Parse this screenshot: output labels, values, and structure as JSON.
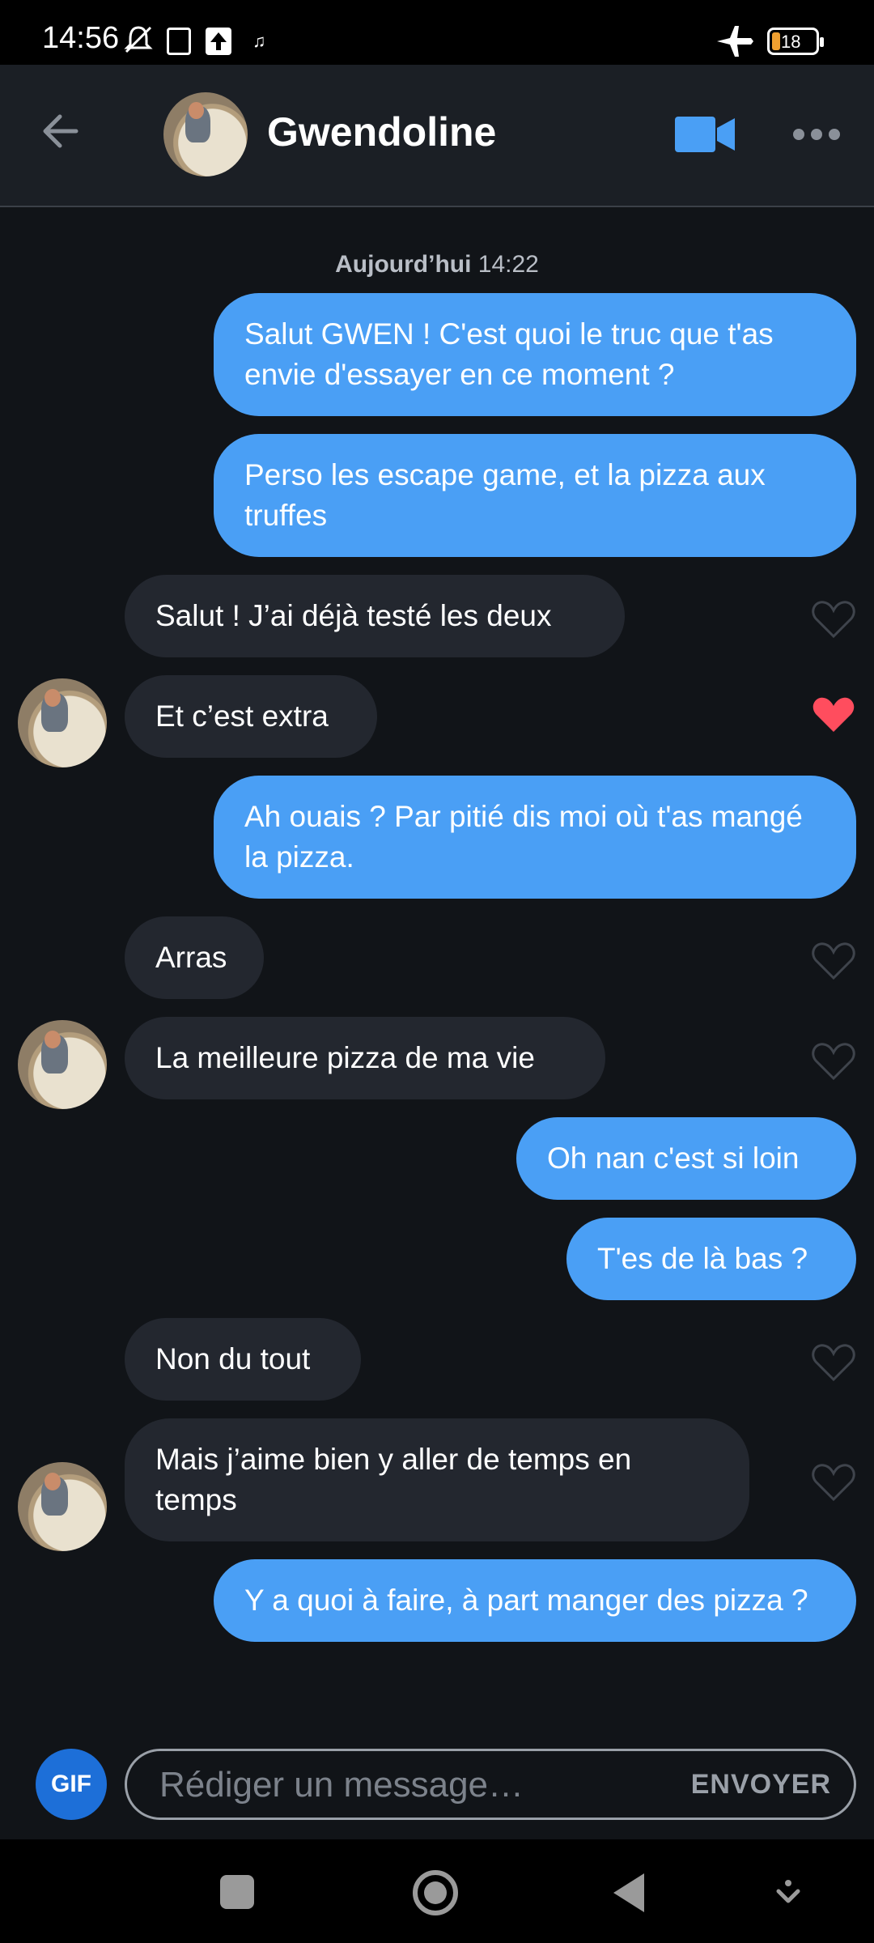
{
  "status_bar": {
    "time": "14:56",
    "battery": "18",
    "icons": [
      "mute-bell-icon",
      "battery-saver-icon",
      "upload-icon",
      "music-icon",
      "airplane-icon",
      "battery-icon"
    ]
  },
  "header": {
    "contact_name": "Gwendoline",
    "icons": [
      "back-arrow-icon",
      "video-camera-icon",
      "more-icon"
    ]
  },
  "chat": {
    "date_label": "Aujourd’hui",
    "date_time": "14:22",
    "messages": [
      {
        "dir": "out",
        "text": "Salut GWEN ! C'est quoi le truc que t'as envie d'essayer en ce moment ?"
      },
      {
        "dir": "out",
        "text": "Perso les escape game, et la pizza aux truffes"
      },
      {
        "dir": "in",
        "text": "Salut ! J’ai déjà testé les deux",
        "liked": false
      },
      {
        "dir": "in",
        "text": "Et c’est extra",
        "liked": true
      },
      {
        "dir": "out",
        "text": "Ah ouais ? Par pitié dis moi où t'as mangé la pizza."
      },
      {
        "dir": "in",
        "text": "Arras",
        "liked": false
      },
      {
        "dir": "in",
        "text": "La meilleure pizza de ma vie",
        "liked": false
      },
      {
        "dir": "out",
        "text": "Oh nan c'est si loin"
      },
      {
        "dir": "out",
        "text": "T'es de là bas ?"
      },
      {
        "dir": "in",
        "text": "Non du tout",
        "liked": false
      },
      {
        "dir": "in",
        "text": "Mais j’aime bien y aller de temps en temps",
        "liked": false
      },
      {
        "dir": "out",
        "text": "Y a quoi à faire, à part manger des pizza ?"
      }
    ]
  },
  "input_bar": {
    "gif_label": "GIF",
    "placeholder": "Rédiger un message…",
    "send_label": "ENVOYER"
  },
  "colors": {
    "outgoing": "#4a9ff5",
    "incoming": "#23272f",
    "like": "#ff4d5e",
    "gif": "#1d6fd8"
  }
}
